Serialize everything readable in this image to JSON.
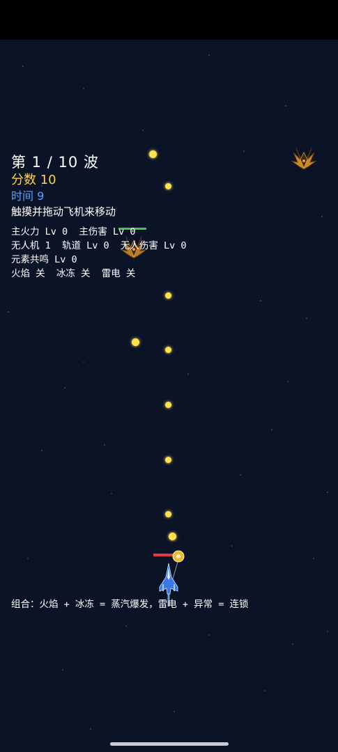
{
  "hud": {
    "wave": "第 1 / 10 波",
    "score": "分数 10",
    "time": "时间 9",
    "hint": "触摸并拖动飞机来移动",
    "stats": [
      "主火力 Lv 0  主伤害 Lv 0",
      "无人机 1  轨道 Lv 0  无人伤害 Lv 0",
      "元素共鸣 Lv 0",
      "火焰 关  冰冻 关  雷电 关"
    ],
    "combo": "组合：火焰 + 冰冻 = 蒸汽爆发，雷电 + 异常 = 连锁"
  },
  "colors": {
    "background": "#0b1327",
    "score": "#ffd24a",
    "time": "#5aa2ff",
    "bullet": "#ffe24a",
    "enemy_hp": "#3ec94a",
    "drone_hp": "#e23b3b",
    "player_ship": "#3a78e6"
  },
  "entities": {
    "enemy_icon": "spiky-alien-fighter-icon",
    "player_icon": "blue-jet-fighter-icon",
    "drone_icon": "orb-drone-icon"
  }
}
